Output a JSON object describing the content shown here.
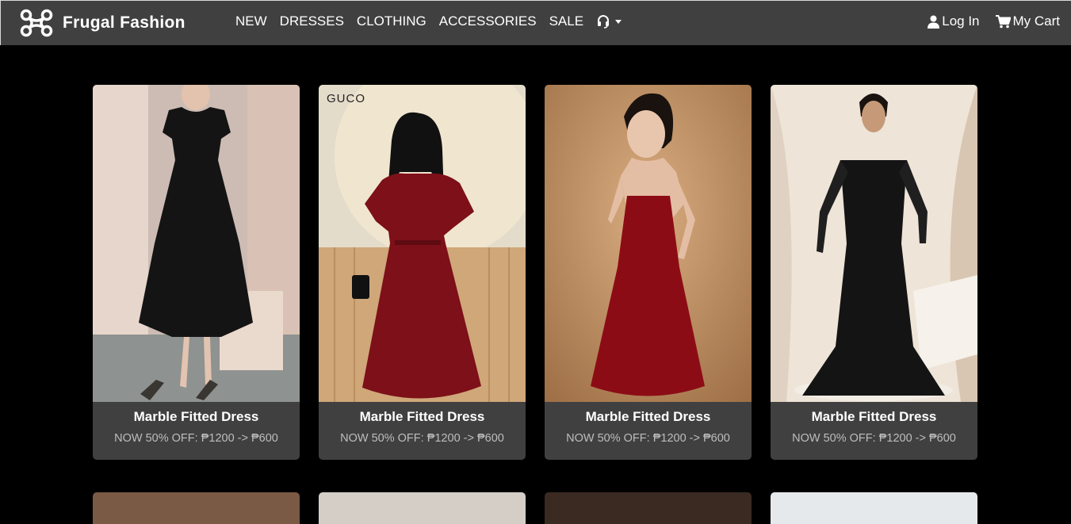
{
  "brand": {
    "name": "Frugal Fashion",
    "logo_icon": "x-shaped-drone-logo-icon"
  },
  "nav": {
    "links": [
      "NEW",
      "DRESSES",
      "CLOTHING",
      "ACCESSORIES",
      "SALE"
    ],
    "support_icon": "headset-icon",
    "login_label": "Log In",
    "cart_label": "My Cart"
  },
  "products": [
    {
      "name": "Marble Fitted Dress",
      "price": "NOW 50% OFF: ₱1200 -> ₱600",
      "image": "woman in black square-neck midi dress"
    },
    {
      "name": "Marble Fitted Dress",
      "price": "NOW 50% OFF: ₱1200 -> ₱600",
      "image": "woman in red jacquard puff-sleeve dress",
      "image_text": "GUCO"
    },
    {
      "name": "Marble Fitted Dress",
      "price": "NOW 50% OFF: ₱1200 -> ₱600",
      "image": "woman in red backless slip dress"
    },
    {
      "name": "Marble Fitted Dress",
      "price": "NOW 50% OFF: ₱1200 -> ₱600",
      "image": "woman in black sequin off-shoulder gown"
    }
  ],
  "colors": {
    "navbar": "#414040",
    "page_bg": "#000000",
    "card_bg": "#414040",
    "price_text": "#bdbdbd"
  }
}
